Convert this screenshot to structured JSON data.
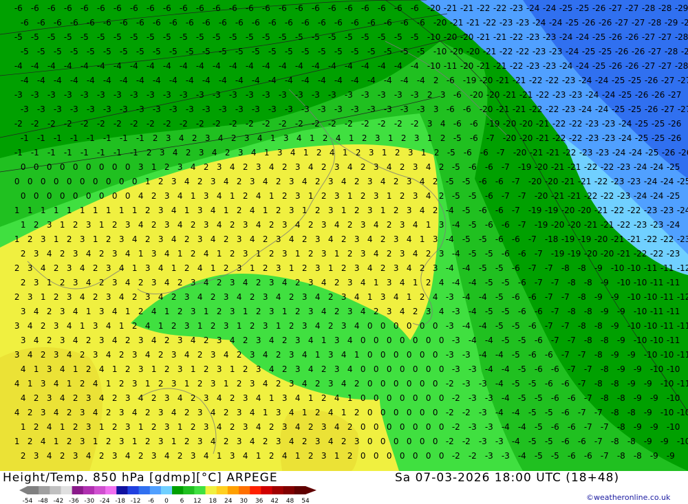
{
  "header": {
    "title": "Height/Temp. 850 hPa [gdmp][°C] ARPEGE",
    "datetime": "Sa 07-03-2026 18:00 UTC (18+48)",
    "credit": "©weatheronline.co.uk"
  },
  "legend": {
    "ticks": [
      "-54",
      "-48",
      "-42",
      "-36",
      "-30",
      "-24",
      "-18",
      "-12",
      "-6",
      "0",
      "6",
      "12",
      "18",
      "24",
      "30",
      "36",
      "42",
      "48",
      "54"
    ],
    "colors": [
      "#808080",
      "#a0a0a0",
      "#c0c0c0",
      "#e0e0e0",
      "#8a1a8a",
      "#b030b0",
      "#d050d0",
      "#f070f0",
      "#1010a0",
      "#2040e0",
      "#3070f0",
      "#50a0ff",
      "#70d0ff",
      "#00a000",
      "#20c020",
      "#40e040",
      "#f0f040",
      "#ffd020",
      "#ffa000",
      "#ff7000",
      "#ff2000",
      "#d00000",
      "#a00000",
      "#800000",
      "#600000"
    ]
  },
  "map": {
    "colors": {
      "green_dark": "#00a000",
      "green_mid": "#20c020",
      "green_light": "#40e040",
      "yellow": "#f0f040",
      "yellow_dark": "#e8e030",
      "blue": "#3070f0",
      "blue_light": "#50a0ff",
      "cyan": "#70d0ff"
    }
  }
}
